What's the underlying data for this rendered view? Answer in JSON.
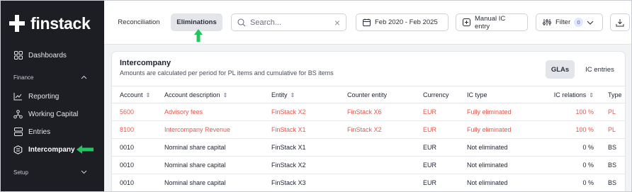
{
  "sidebar": {
    "logo": "finstack",
    "items": [
      {
        "label": "Dashboards"
      },
      {
        "label": "Reporting"
      },
      {
        "label": "Working Capital"
      },
      {
        "label": "Entries"
      },
      {
        "label": "Intercompany"
      }
    ],
    "sections": {
      "finance": "Finance",
      "setup": "Setup"
    }
  },
  "topbar": {
    "tabs": [
      {
        "label": "Reconciliation"
      },
      {
        "label": "Eliminations"
      }
    ],
    "search_placeholder": "Search...",
    "date_range": "Feb 2020 - Feb 2025",
    "manual_entry": "Manual IC entry",
    "filter_label": "Filter",
    "filter_count": "0"
  },
  "card": {
    "title": "Intercompany",
    "subtitle": "Amounts are calculated per period for PL items and cumulative for BS items",
    "toggle": [
      {
        "label": "GLAs"
      },
      {
        "label": "IC entries"
      }
    ]
  },
  "table": {
    "headers": [
      "Account",
      "Account description",
      "Entity",
      "Counter entity",
      "Currency",
      "IC type",
      "IC relations",
      "Type"
    ],
    "rows": [
      {
        "account": "5600",
        "description": "Advisory fees",
        "entity": "FinStack X2",
        "counter": "FinStack X6",
        "currency": "EUR",
        "ic_type": "Fully eliminated",
        "relations": "100 %",
        "type": "PL"
      },
      {
        "account": "8100",
        "description": "Intercompany Revenue",
        "entity": "FinStack X1",
        "counter": "FinStack X2",
        "currency": "EUR",
        "ic_type": "Fully eliminated",
        "relations": "100 %",
        "type": "PL"
      },
      {
        "account": "0010",
        "description": "Nominal share capital",
        "entity": "FinStack X1",
        "counter": "",
        "currency": "EUR",
        "ic_type": "Not eliminated",
        "relations": "0 %",
        "type": "BS"
      },
      {
        "account": "0010",
        "description": "Nominal share capital",
        "entity": "FinStack X2",
        "counter": "",
        "currency": "EUR",
        "ic_type": "Not eliminated",
        "relations": "0 %",
        "type": "BS"
      },
      {
        "account": "0010",
        "description": "Nominal share capital",
        "entity": "FinStack X3",
        "counter": "",
        "currency": "EUR",
        "ic_type": "Not eliminated",
        "relations": "0 %",
        "type": "BS"
      }
    ]
  },
  "colors": {
    "accent_red": "#e05a4e",
    "sidebar_bg": "#1c1e24",
    "highlight_arrow": "#22c55e",
    "active_tab_bg": "#e3e5ea"
  }
}
